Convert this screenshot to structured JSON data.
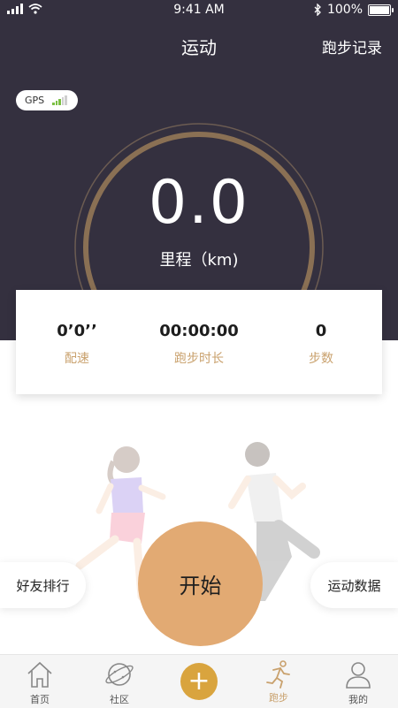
{
  "status_bar": {
    "time": "9:41 AM",
    "battery": "100%"
  },
  "header": {
    "title": "运动",
    "records_label": "跑步记录"
  },
  "gps": {
    "label": "GPS"
  },
  "distance": {
    "value": "0.0",
    "label": "里程（km)"
  },
  "stats": [
    {
      "value": "0’0’’",
      "label": "配速"
    },
    {
      "value": "00:00:00",
      "label": "跑步时长"
    },
    {
      "value": "0",
      "label": "步数"
    }
  ],
  "actions": {
    "friends_rank": "好友排行",
    "start": "开始",
    "sport_data": "运动数据"
  },
  "tabs": [
    {
      "label": "首页",
      "icon": "home-icon"
    },
    {
      "label": "社区",
      "icon": "planet-icon"
    },
    {
      "label": "",
      "icon": "plus-icon"
    },
    {
      "label": "跑步",
      "icon": "runner-icon"
    },
    {
      "label": "我的",
      "icon": "user-icon"
    }
  ],
  "colors": {
    "header_bg": "#34303f",
    "accent": "#c9a16d",
    "start_button": "#e2aa73",
    "plus_button": "#d9a43e"
  }
}
